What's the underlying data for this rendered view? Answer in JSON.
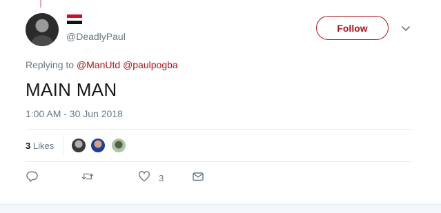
{
  "tweet": {
    "handle": "@DeadlyPaul",
    "follow_label": "Follow",
    "replying_prefix": "Replying to",
    "mentions": [
      "@ManUtd",
      "@paulpogba"
    ],
    "text": "MAIN MAN",
    "timestamp": "1:00 AM - 30 Jun 2018",
    "likes_count": "3",
    "likes_label": "Likes",
    "like_action_count": "3"
  },
  "colors": {
    "accent": "#b31217",
    "muted": "#657786",
    "text": "#14171a"
  },
  "icons": [
    "yemen-flag-icon",
    "chevron-down-icon",
    "reply-icon",
    "retweet-icon",
    "heart-icon",
    "envelope-icon"
  ]
}
